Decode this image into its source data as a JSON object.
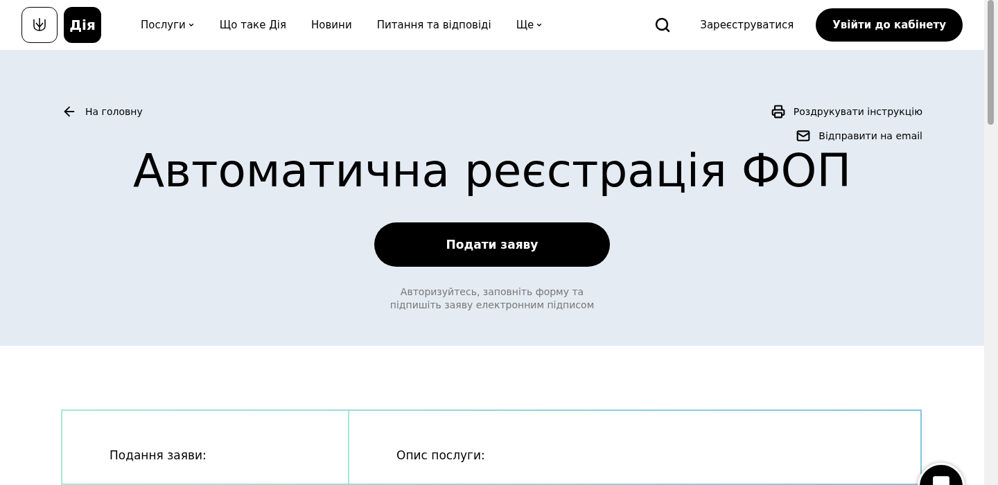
{
  "header": {
    "logo_text": "Дія",
    "nav": [
      {
        "label": "Послуги",
        "dropdown": true
      },
      {
        "label": "Що таке Дія",
        "dropdown": false
      },
      {
        "label": "Новини",
        "dropdown": false
      },
      {
        "label": "Питання та відповіді",
        "dropdown": false
      },
      {
        "label": "Ще",
        "dropdown": true
      }
    ],
    "register": "Зареєструватися",
    "login": "Увійти до кабінету"
  },
  "hero": {
    "back": "На головну",
    "actions": [
      {
        "kind": "print",
        "label": "Роздрукувати інструкцію"
      },
      {
        "kind": "email",
        "label": "Відправити на email"
      }
    ],
    "title": "Автоматична реєстрація ФОП",
    "button": "Подати заяву",
    "note": [
      "Авторизуйтесь, заповніть форму та",
      "підпишіть заяву електронним підписом"
    ]
  },
  "info": {
    "columns": [
      "Подання заяви:",
      "Опис послуги:"
    ]
  }
}
